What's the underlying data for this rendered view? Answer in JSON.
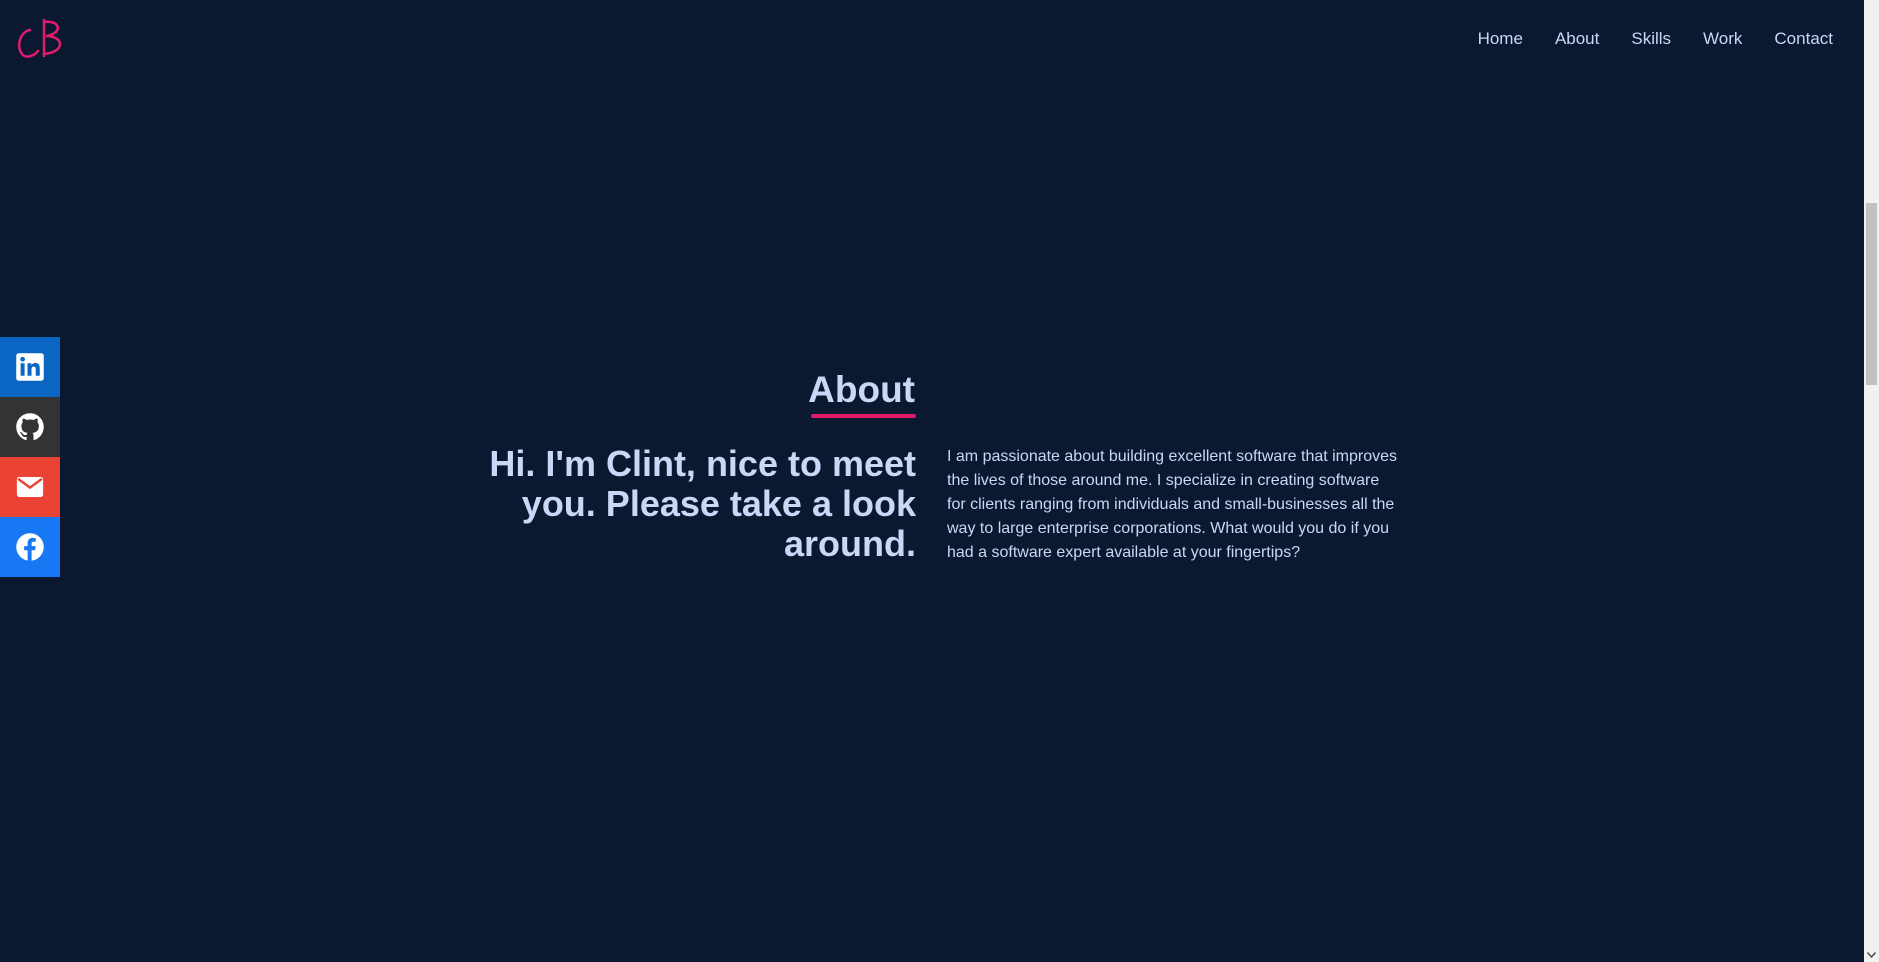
{
  "header": {
    "logo_text": "CB",
    "nav": [
      "Home",
      "About",
      "Skills",
      "Work",
      "Contact"
    ]
  },
  "social": [
    {
      "name": "linkedin",
      "icon": "linkedin-icon",
      "color": "#0a66c2"
    },
    {
      "name": "github",
      "icon": "github-icon",
      "color": "#333333"
    },
    {
      "name": "email",
      "icon": "mail-icon",
      "color": "#ea4335"
    },
    {
      "name": "facebook",
      "icon": "facebook-icon",
      "color": "#1877f2"
    }
  ],
  "about": {
    "title": "About",
    "tagline": "Hi. I'm Clint, nice to meet you. Please take a look around.",
    "bio": "I am passionate about building excellent software that improves the lives of those around me. I specialize in creating software for clients ranging from individuals and small-businesses all the way to large enterprise corporations. What would you do if you had a software expert available at your fingertips?"
  },
  "colors": {
    "background": "#0a1930",
    "accent": "#e31b6d",
    "text": "#ccd6f6"
  }
}
